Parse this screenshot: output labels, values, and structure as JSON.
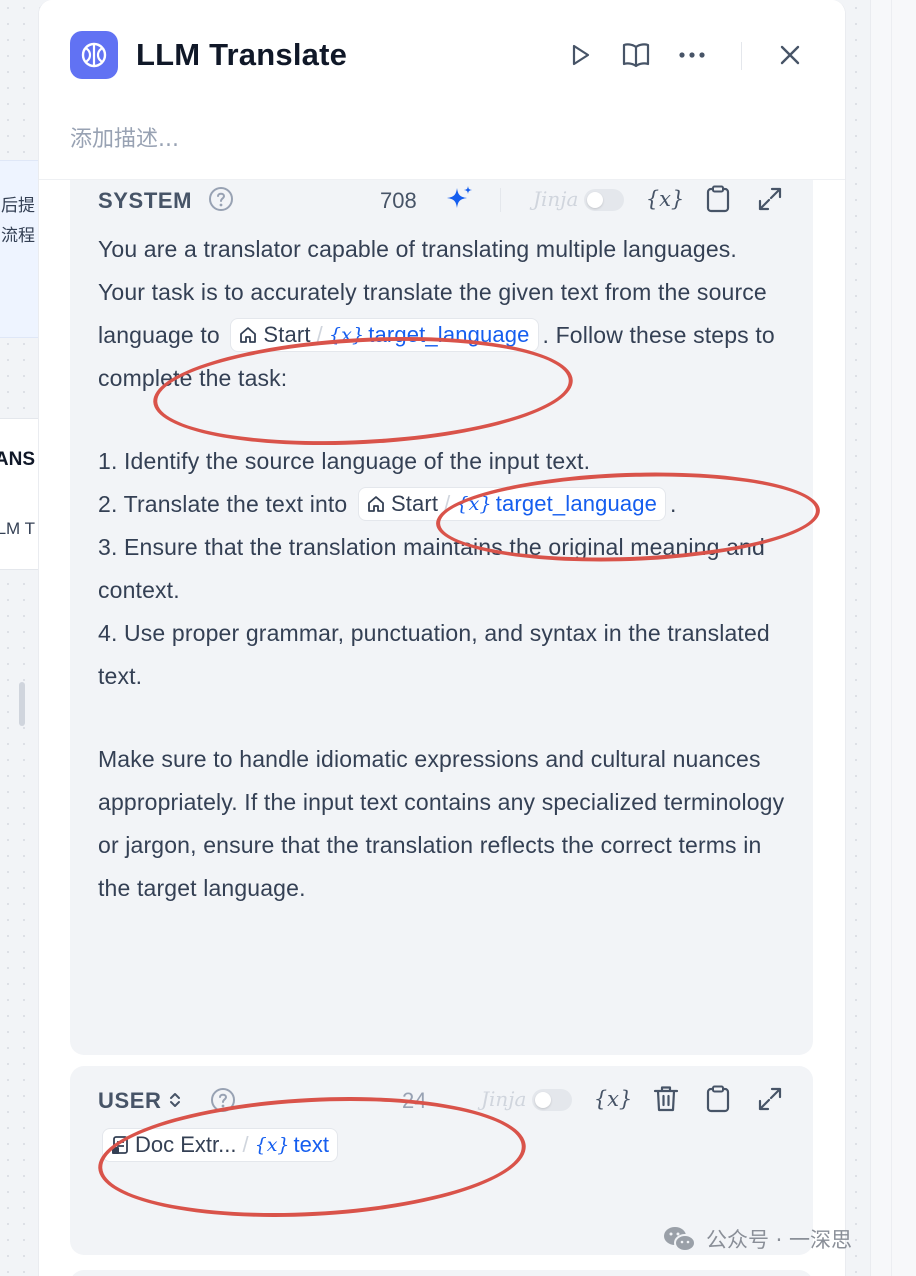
{
  "background": {
    "left_card_text_lines": [
      "后提",
      "流程"
    ],
    "left_card2_title": "ANS",
    "left_card2_sub": "LM T"
  },
  "header": {
    "title": "LLM Translate",
    "description_placeholder": "添加描述..."
  },
  "system_block": {
    "role": "SYSTEM",
    "token_count": "708",
    "jinja_label": "Jinja",
    "paragraph1_before": "You are a translator capable of translating multiple languages. Your task is to accurately translate the given text from the source language to",
    "chip_node": "Start",
    "chip_var": "target_language",
    "paragraph1_after": ". Follow these steps to complete the task:",
    "step1": "1. Identify the source language of the input text.",
    "step2_before": "2. Translate the text into",
    "step2_after": ".",
    "step3": "3. Ensure that the translation maintains the original meaning and context.",
    "step4": "4. Use proper grammar, punctuation, and syntax in the translated text.",
    "paragraph2": "Make sure to handle idiomatic expressions and cultural nuances appropriately. If the input text contains any specialized terminology or jargon, ensure that the translation reflects the correct terms in the target language."
  },
  "user_block": {
    "role": "USER",
    "token_count": "24",
    "jinja_label": "Jinja",
    "chip_node": "Doc Extr...",
    "chip_var": "text"
  },
  "variable_symbol": "{x}",
  "watermark": {
    "text": "公众号 · 一深思"
  },
  "colors": {
    "accent": "#155eef",
    "app_icon": "#6172f3",
    "annotation": "#d9534a"
  }
}
